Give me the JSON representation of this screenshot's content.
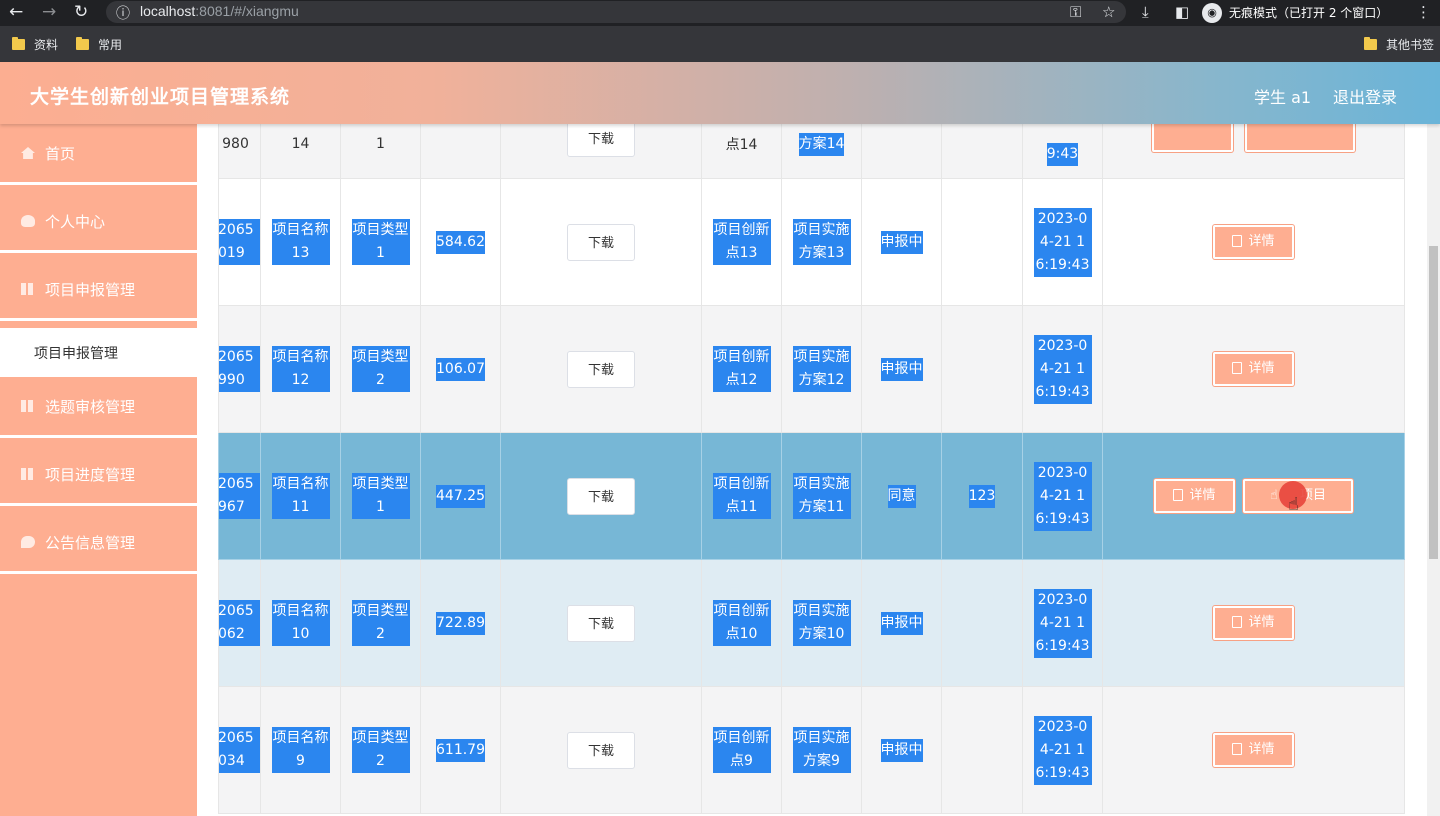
{
  "browser": {
    "url_host": "localhost",
    "url_port": ":8081",
    "url_path": "/#/xiangmu",
    "incognito_label": "无痕模式（已打开 2 个窗口）",
    "incognito_avatar": "◉",
    "bookmarks": [
      "资料",
      "常用"
    ],
    "other_bookmarks": "其他书签"
  },
  "header": {
    "title": "大学生创新创业项目管理系统",
    "user": "学生 a1",
    "logout": "退出登录"
  },
  "sidebar": {
    "items": [
      {
        "label": "首页",
        "icon": "home-icon"
      },
      {
        "label": "个人中心",
        "icon": "user-icon"
      },
      {
        "label": "项目申报管理",
        "icon": "grid-icon"
      },
      {
        "label": "选题审核管理",
        "icon": "grid-icon"
      },
      {
        "label": "项目进度管理",
        "icon": "grid-icon"
      },
      {
        "label": "公告信息管理",
        "icon": "chat-icon"
      }
    ],
    "active_sub": "项目申报管理"
  },
  "table": {
    "download_label": "下载",
    "detail_label": "详情",
    "action_label": "项目",
    "rows": [
      {
        "id_a": "980",
        "id_b": "",
        "name": "14",
        "type": "1",
        "budget": "",
        "innov": "点14",
        "plan": "方案14",
        "status": "",
        "opinion": "",
        "time": "9:43"
      },
      {
        "id_a": "2065",
        "id_b": "019",
        "name": "项目名称13",
        "type": "项目类型1",
        "budget": "584.62",
        "innov": "项目创新点13",
        "plan": "项目实施方案13",
        "status": "申报中",
        "opinion": "",
        "time": "2023-04-21 16:19:43"
      },
      {
        "id_a": "2065",
        "id_b": "990",
        "name": "项目名称12",
        "type": "项目类型2",
        "budget": "106.07",
        "innov": "项目创新点12",
        "plan": "项目实施方案12",
        "status": "申报中",
        "opinion": "",
        "time": "2023-04-21 16:19:43"
      },
      {
        "id_a": "2065",
        "id_b": "967",
        "name": "项目名称11",
        "type": "项目类型1",
        "budget": "447.25",
        "innov": "项目创新点11",
        "plan": "项目实施方案11",
        "status": "同意",
        "opinion": "123",
        "time": "2023-04-21 16:19:43"
      },
      {
        "id_a": "2065",
        "id_b": "062",
        "name": "项目名称10",
        "type": "项目类型2",
        "budget": "722.89",
        "innov": "项目创新点10",
        "plan": "项目实施方案10",
        "status": "申报中",
        "opinion": "",
        "time": "2023-04-21 16:19:43"
      },
      {
        "id_a": "2065",
        "id_b": "034",
        "name": "项目名称9",
        "type": "项目类型2",
        "budget": "611.79",
        "innov": "项目创新点9",
        "plan": "项目实施方案9",
        "status": "申报中",
        "opinion": "",
        "time": "2023-04-21 16:19:43"
      }
    ]
  }
}
